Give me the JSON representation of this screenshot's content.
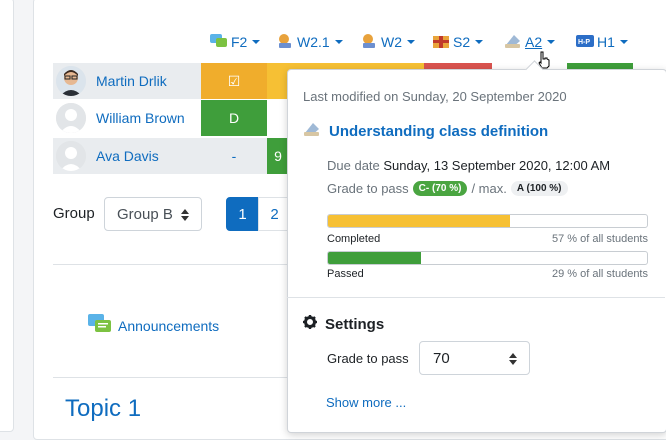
{
  "toolbar": {
    "items": [
      {
        "label": "F2",
        "icon": "forum-icon"
      },
      {
        "label": "W2.1",
        "icon": "workshop-icon"
      },
      {
        "label": "W2",
        "icon": "workshop-icon"
      },
      {
        "label": "S2",
        "icon": "scorm-icon"
      },
      {
        "label": "A2",
        "icon": "assignment-icon",
        "active": true
      },
      {
        "label": "H1",
        "icon": "h5p-icon"
      }
    ]
  },
  "students": [
    {
      "name": "Martin Drlik",
      "first_cell": "☑",
      "first_color": "#f0ad2c"
    },
    {
      "name": "William Brown",
      "first_cell": "D",
      "first_color": "#3f9e3b"
    },
    {
      "name": "Ava Davis",
      "first_cell": "-",
      "first_color": "#ffffff",
      "second_cell": "9"
    }
  ],
  "filter": {
    "group_label": "Group",
    "group_value": "Group B"
  },
  "pagination": {
    "pages": [
      "1",
      "2"
    ],
    "current": "1"
  },
  "announcements": {
    "label": "Announcements"
  },
  "topic": {
    "title": "Topic 1"
  },
  "popover": {
    "last_modified": "Last modified on Sunday, 20 September 2020",
    "title": "Understanding class definition",
    "due_label": "Due date",
    "due_value": "Sunday, 13 September 2020, 12:00 AM",
    "grade_to_pass_label": "Grade to pass",
    "grade_to_pass_badge": "C- (70 %)",
    "max_label": "/ max.",
    "max_badge": "A (100 %)",
    "completed": {
      "label": "Completed",
      "percent_text": "57 % of all students",
      "fraction": 0.57,
      "color": "#f6c034"
    },
    "passed": {
      "label": "Passed",
      "percent_text": "29 % of all students",
      "fraction": 0.29,
      "color": "#3f9e3b"
    },
    "settings_title": "Settings",
    "settings_grade_label": "Grade to pass",
    "settings_grade_value": "70",
    "show_more": "Show more ..."
  },
  "colors": {
    "accent": "#0f6cbf",
    "success": "#3f9e3b",
    "warning": "#f0ad2c",
    "danger": "#d9534f"
  }
}
